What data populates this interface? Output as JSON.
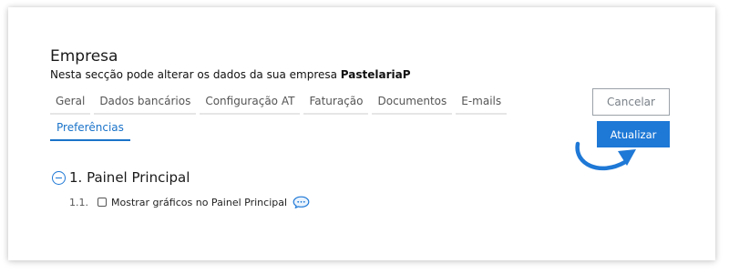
{
  "header": {
    "title": "Empresa",
    "subtitle_prefix": "Nesta secção pode alterar os dados da sua empresa ",
    "company_name": "PastelariaP"
  },
  "tabs": [
    {
      "label": "Geral"
    },
    {
      "label": "Dados bancários"
    },
    {
      "label": "Configuração AT"
    },
    {
      "label": "Faturação"
    },
    {
      "label": "Documentos"
    },
    {
      "label": "E-mails"
    },
    {
      "label": "Preferências",
      "active": true
    }
  ],
  "actions": {
    "cancel_label": "Cancelar",
    "update_label": "Atualizar"
  },
  "section": {
    "title": "1. Painel Principal",
    "options": [
      {
        "number": "1.1.",
        "label": "Mostrar gráficos no Painel Principal",
        "checked": false
      }
    ]
  },
  "colors": {
    "accent": "#1e78d6",
    "active_tab": "#1a73c9"
  },
  "icons": {
    "section_toggle": "collapse-circle-icon",
    "option_help": "comment-bubble-icon",
    "pointer": "curved-arrow-icon"
  }
}
